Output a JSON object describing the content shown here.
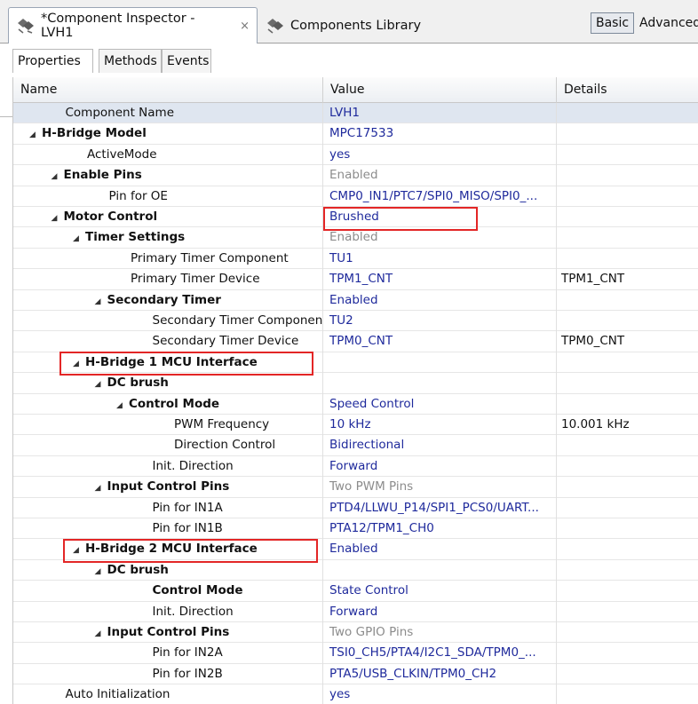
{
  "tabs": {
    "active_label": "*Component Inspector - LVH1",
    "close_glyph": "×",
    "library_label": "Components Library",
    "icon": "component-gem-icon"
  },
  "modes": {
    "basic": "Basic",
    "advanced": "Advanced"
  },
  "subtabs": [
    "Properties",
    "Methods",
    "Events"
  ],
  "columns": {
    "name": "Name",
    "value": "Value",
    "details": "Details"
  },
  "rows": [
    {
      "name": "Component Name",
      "value": "LVH1",
      "details": "",
      "level": 1,
      "expander": false,
      "bold": false,
      "muted": false
    },
    {
      "name": "H-Bridge Model",
      "value": "MPC17533",
      "details": "",
      "level": 0,
      "expander": true,
      "bold": true,
      "muted": false
    },
    {
      "name": "ActiveMode",
      "value": "yes",
      "details": "",
      "level": 2,
      "expander": false,
      "bold": false,
      "muted": false
    },
    {
      "name": "Enable Pins",
      "value": "Enabled",
      "details": "",
      "level": 1,
      "expander": true,
      "bold": true,
      "muted": true
    },
    {
      "name": "Pin for OE",
      "value": "CMP0_IN1/PTC7/SPI0_MISO/SPI0_...",
      "details": "",
      "level": 3,
      "expander": false,
      "bold": false,
      "muted": false
    },
    {
      "name": "Motor Control",
      "value": "Brushed",
      "details": "",
      "level": 1,
      "expander": true,
      "bold": true,
      "muted": false
    },
    {
      "name": "Timer Settings",
      "value": "Enabled",
      "details": "",
      "level": 2,
      "expander": true,
      "bold": true,
      "muted": true
    },
    {
      "name": "Primary Timer Component",
      "value": "TU1",
      "details": "",
      "level": 4,
      "expander": false,
      "bold": false,
      "muted": false
    },
    {
      "name": "Primary Timer Device",
      "value": "TPM1_CNT",
      "details": "TPM1_CNT",
      "level": 4,
      "expander": false,
      "bold": false,
      "muted": false
    },
    {
      "name": "Secondary Timer",
      "value": "Enabled",
      "details": "",
      "level": 3,
      "expander": true,
      "bold": true,
      "muted": false
    },
    {
      "name": "Secondary Timer Component",
      "value": "TU2",
      "details": "",
      "level": 5,
      "expander": false,
      "bold": false,
      "muted": false
    },
    {
      "name": "Secondary Timer Device",
      "value": "TPM0_CNT",
      "details": "TPM0_CNT",
      "level": 5,
      "expander": false,
      "bold": false,
      "muted": false
    },
    {
      "name": "H-Bridge 1 MCU Interface",
      "value": "",
      "details": "",
      "level": 2,
      "expander": true,
      "bold": true,
      "muted": false
    },
    {
      "name": "DC brush",
      "value": "",
      "details": "",
      "level": 3,
      "expander": true,
      "bold": true,
      "muted": false
    },
    {
      "name": "Control Mode",
      "value": "Speed Control",
      "details": "",
      "level": 4,
      "expander": true,
      "bold": true,
      "muted": false
    },
    {
      "name": "PWM Frequency",
      "value": "10 kHz",
      "details": "10.001 kHz",
      "level": 6,
      "expander": false,
      "bold": false,
      "muted": false
    },
    {
      "name": "Direction Control",
      "value": "Bidirectional",
      "details": "",
      "level": 6,
      "expander": false,
      "bold": false,
      "muted": false
    },
    {
      "name": "Init. Direction",
      "value": "Forward",
      "details": "",
      "level": 5,
      "expander": false,
      "bold": false,
      "muted": false
    },
    {
      "name": "Input Control Pins",
      "value": "Two PWM Pins",
      "details": "",
      "level": 3,
      "expander": true,
      "bold": true,
      "muted": true
    },
    {
      "name": "Pin for IN1A",
      "value": "PTD4/LLWU_P14/SPI1_PCS0/UART...",
      "details": "",
      "level": 5,
      "expander": false,
      "bold": false,
      "muted": false
    },
    {
      "name": "Pin for IN1B",
      "value": "PTA12/TPM1_CH0",
      "details": "",
      "level": 5,
      "expander": false,
      "bold": false,
      "muted": false
    },
    {
      "name": "H-Bridge 2 MCU Interface",
      "value": "Enabled",
      "details": "",
      "level": 2,
      "expander": true,
      "bold": true,
      "muted": false
    },
    {
      "name": "DC brush",
      "value": "",
      "details": "",
      "level": 3,
      "expander": true,
      "bold": true,
      "muted": false
    },
    {
      "name": "Control Mode",
      "value": "State Control",
      "details": "",
      "level": 5,
      "expander": false,
      "bold": true,
      "muted": false
    },
    {
      "name": "Init. Direction",
      "value": "Forward",
      "details": "",
      "level": 5,
      "expander": false,
      "bold": false,
      "muted": false
    },
    {
      "name": "Input Control Pins",
      "value": "Two GPIO Pins",
      "details": "",
      "level": 3,
      "expander": true,
      "bold": true,
      "muted": true
    },
    {
      "name": "Pin for IN2A",
      "value": "TSI0_CH5/PTA4/I2C1_SDA/TPM0_...",
      "details": "",
      "level": 5,
      "expander": false,
      "bold": false,
      "muted": false
    },
    {
      "name": "Pin for IN2B",
      "value": "PTA5/USB_CLKIN/TPM0_CH2",
      "details": "",
      "level": 5,
      "expander": false,
      "bold": false,
      "muted": false
    },
    {
      "name": "Auto Initialization",
      "value": "yes",
      "details": "",
      "level": 1,
      "expander": false,
      "bold": false,
      "muted": false
    }
  ],
  "colors": {
    "value_text": "#1f2a9c",
    "muted_text": "#8c8c8c",
    "highlight_box": "#e32626",
    "selected_row": "#dfe6f0"
  }
}
